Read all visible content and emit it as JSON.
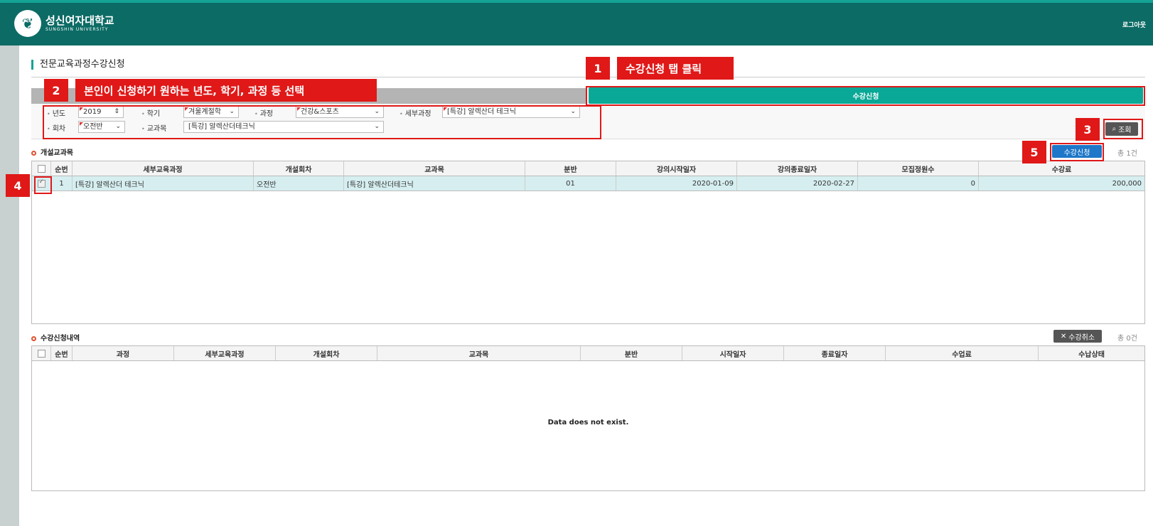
{
  "header": {
    "university_kr": "성신여자대학교",
    "university_en": "SUNGSHIN UNIVERSITY",
    "logout": "로그아웃"
  },
  "page": {
    "title": "전문교육과정수강신청"
  },
  "tab": {
    "label": "수강신청"
  },
  "search": {
    "year_label": "년도",
    "year_value": "2019",
    "semester_label": "학기",
    "semester_value": "겨울계절학",
    "course_label": "과정",
    "course_value": "건강&스포츠",
    "detail_label": "세부과정",
    "detail_value": "[특강] 알렉산더 테크닉",
    "session_label": "회차",
    "session_value": "오전반",
    "subject_label": "교과목",
    "subject_value": "[특강] 알렉산더테크닉",
    "search_button": "조회"
  },
  "open_courses": {
    "title": "개설교과목",
    "apply_button": "수강신청",
    "count": "총 1건",
    "columns": [
      "순번",
      "세부교육과정",
      "개설회차",
      "교과목",
      "분반",
      "강의시작일자",
      "강의종료일자",
      "모집정원수",
      "수강료"
    ],
    "rows": [
      [
        "1",
        "[특강] 알렉산더 테크닉",
        "오전반",
        "[특강] 알렉산더테크닉",
        "01",
        "2020-01-09",
        "2020-02-27",
        "0",
        "200,000"
      ]
    ]
  },
  "history": {
    "title": "수강신청내역",
    "cancel_button": "수강취소",
    "count": "총 0건",
    "columns": [
      "순번",
      "과정",
      "세부교육과정",
      "개설회차",
      "교과목",
      "분반",
      "시작일자",
      "종료일자",
      "수업료",
      "수납상태"
    ],
    "empty_message": "Data does not exist."
  },
  "annotations": {
    "n1": "1",
    "t1": "수강신청 탭 클릭",
    "n2": "2",
    "t2": "본인이 신청하기 원하는 년도, 학기, 과정 등 선택",
    "n3": "3",
    "n4": "4",
    "n5": "5"
  },
  "colors": {
    "header_bg": "#0c6b65",
    "tab_active": "#0aa896",
    "apply_button": "#1e77c8",
    "annotation_red": "#e01818",
    "selected_row": "#d6eef0"
  }
}
